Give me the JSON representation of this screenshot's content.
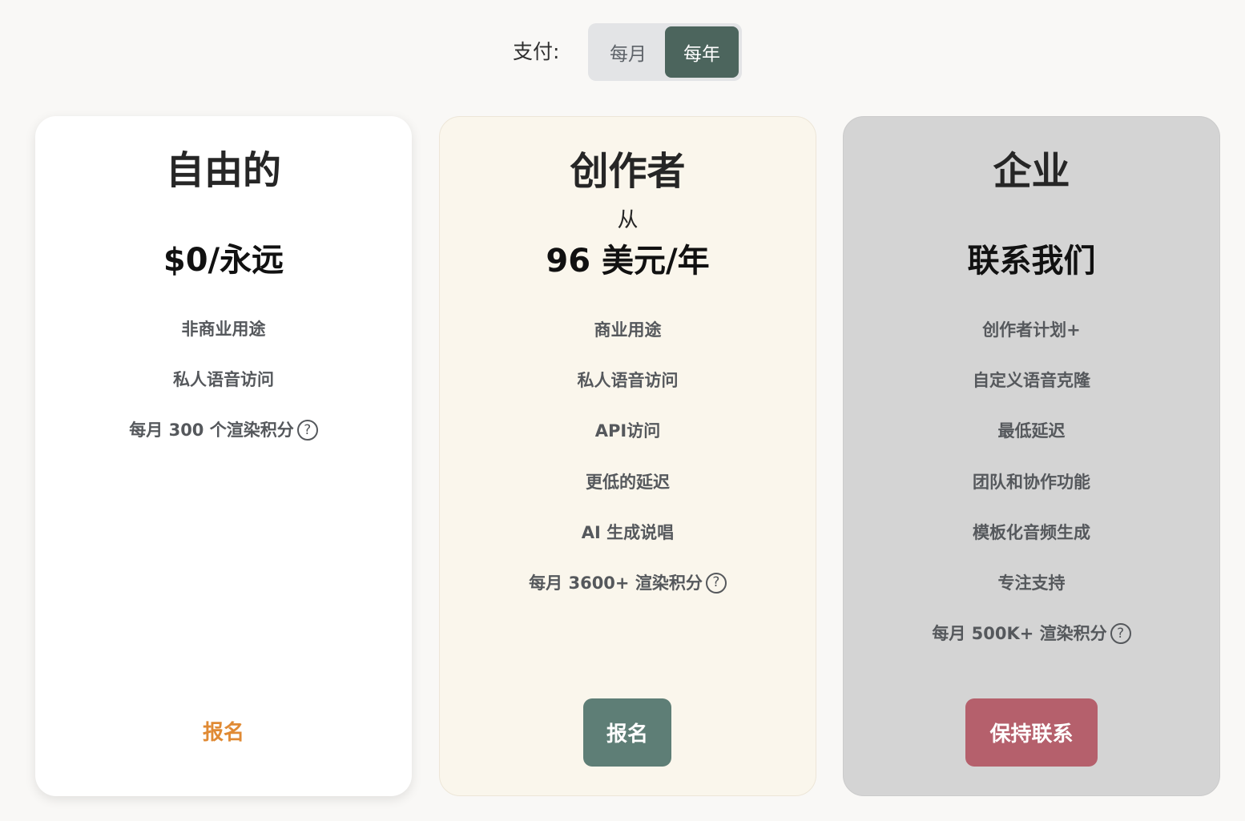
{
  "billing": {
    "label": "支付:",
    "options": [
      "每月",
      "每年"
    ],
    "selected": "每年"
  },
  "plans": [
    {
      "name": "自由的",
      "price": "$0/永远",
      "features": [
        "非商业用途",
        "私人语音访问",
        "每月 300 个渲染积分"
      ],
      "cta": "报名"
    },
    {
      "name": "创作者",
      "price_prefix": "从",
      "price": "96 美元/年",
      "features": [
        "商业用途",
        "私人语音访问",
        "API访问",
        "更低的延迟",
        "AI 生成说唱",
        "每月 3600+ 渲染积分"
      ],
      "cta": "报名"
    },
    {
      "name": "企业",
      "price": "联系我们",
      "features": [
        "创作者计划+",
        "自定义语音克隆",
        "最低延迟",
        "团队和协作功能",
        "模板化音频生成",
        "专注支持",
        "每月 500K+ 渲染积分"
      ],
      "cta": "保持联系"
    }
  ],
  "icons": {
    "help": "?"
  },
  "colors": {
    "toggle_active": "#4c655d",
    "free_cta": "#e08a34",
    "creator_cta": "#5e7e76",
    "enterprise_cta": "#b5606c",
    "creator_card": "#faf6ec",
    "enterprise_card": "#d4d4d4"
  }
}
